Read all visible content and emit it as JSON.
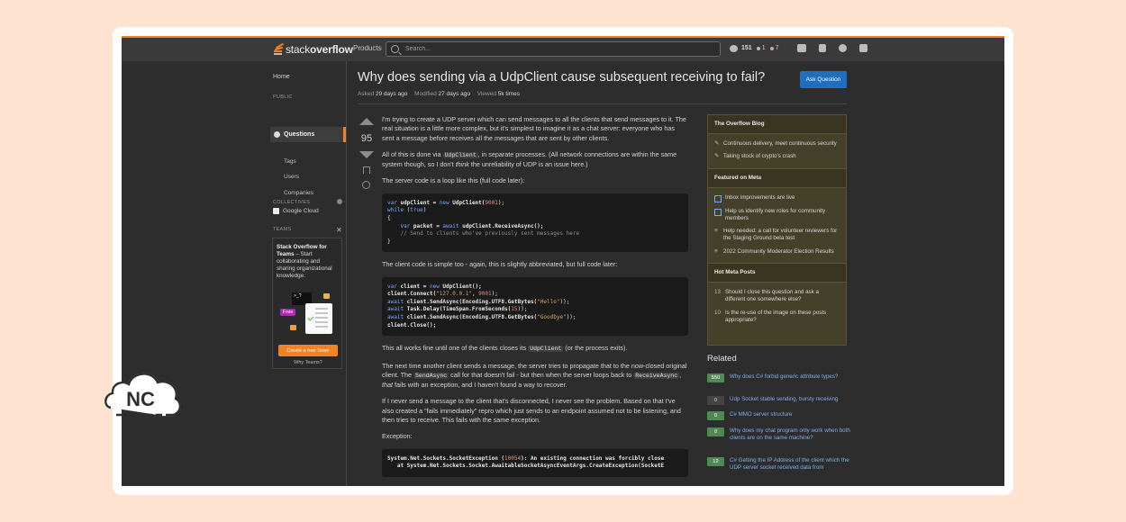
{
  "topbar": {
    "logo_light": "stack",
    "logo_bold": "overflow",
    "products": "Products",
    "search_placeholder": "Search...",
    "reputation": "151",
    "silver": "1",
    "bronze": "7"
  },
  "leftnav": {
    "home": "Home",
    "public": "PUBLIC",
    "questions": "Questions",
    "tags": "Tags",
    "users": "Users",
    "companies": "Companies",
    "collectives": "COLLECTIVES",
    "google_cloud": "Google Cloud",
    "teams": "TEAMS",
    "teams_title": "Stack Overflow for Teams",
    "teams_desc": " – Start collaborating and sharing organizational knowledge.",
    "free": "Free",
    "terminal": ">_?",
    "create_team": "Create a free Team",
    "why_teams": "Why Teams?"
  },
  "question": {
    "title": "Why does sending via a UdpClient cause subsequent receiving to fail?",
    "ask_button": "Ask Question",
    "asked_label": "Asked",
    "asked_value": "29 days ago",
    "modified_label": "Modified",
    "modified_value": "27 days ago",
    "viewed_label": "Viewed",
    "viewed_value": "5k times",
    "votes": "95"
  },
  "post": {
    "p1": "I'm trying to create a UDP server which can send messages to all the clients that send messages to it. The real situation is a little more complex, but it's simplest to imagine it as a chat server: everyone who has sent a message before receives all the messages that are sent by other clients.",
    "p2a": "All of this is done via ",
    "p2code": "UdpClient",
    "p2b": ", in separate processes. (All network connections are within the same system though, so I don't ",
    "p2em": "think",
    "p2c": " the unreliability of UDP is an issue here.)",
    "p3": "The server code is a loop like this (full code later):",
    "p4": "The client code is simple too - again, this is slightly abbreviated, but full code later:",
    "p5a": "This all works fine until one of the clients closes its ",
    "p5code": "UdpClient",
    "p5b": " (or the process exits).",
    "p6a": "The next time another client sends a message, the server tries to propagate that to the now-closed original client. The ",
    "p6code1": "SendAsync",
    "p6b": " call for that doesn't fail - but then when the server loops back to ",
    "p6code2": "ReceiveAsync",
    "p6c": ", ",
    "p6em": "that",
    "p6d": " fails with an exception, and I haven't found a way to recover.",
    "p7": "If I never send a message to the client that's disconnected, I never see the problem. Based on that I've also created a \"fails immediately\" repro which just sends to an endpoint assumed not to be listening, and then tries to receive. This fails with the same exception.",
    "p8": "Exception:",
    "server_code": {
      "l1_kw": "var",
      "l1_a": " udpClient = ",
      "l1_new": "new",
      "l1_b": " UdpClient(",
      "l1_num": "9001",
      "l1_c": ");",
      "l2_kw": "while",
      "l2_a": " (",
      "l2_true": "true",
      "l2_b": ")",
      "l3": "{",
      "l4_kw": "var",
      "l4_a": " packet = ",
      "l4_await": "await",
      "l4_b": " udpClient.ReceiveAsync();",
      "l5": "// Send to clients who've previously sent messages here",
      "l6": "}"
    },
    "client_code": {
      "l1_kw": "var",
      "l1_a": " client = ",
      "l1_new": "new",
      "l1_b": " UdpClient();",
      "l2_a": "client.Connect(",
      "l2_str": "\"127.0.0.1\"",
      "l2_b": ", ",
      "l2_num": "9001",
      "l2_c": ");",
      "l3_await": "await",
      "l3_a": " client.SendAsync(Encoding.UTF8.GetBytes(",
      "l3_str": "\"Hello\"",
      "l3_b": "));",
      "l4_await": "await",
      "l4_a": " Task.Delay(TimeSpan.FromSeconds(",
      "l4_num": "15",
      "l4_b": "));",
      "l5_await": "await",
      "l5_a": " client.SendAsync(Encoding.UTF8.GetBytes(",
      "l5_str": "\"Goodbye\"",
      "l5_b": "));",
      "l6": "client.Close();"
    },
    "exception_code": {
      "l1_a": "System.Net.Sockets.SocketException (",
      "l1_num": "10054",
      "l1_b": "): An existing connection was forcibly close",
      "l2": "   at System.Net.Sockets.Socket.AwaitableSocketAsyncEventArgs.CreateException(SocketE"
    }
  },
  "sidebar": {
    "blog_head": "The Overflow Blog",
    "blog_items": [
      "Continuous delivery, meet continuous security",
      "Taking stock of crypto's crash"
    ],
    "meta_head": "Featured on Meta",
    "meta_items": [
      "Inbox improvements are live",
      "Help us identify new roles for community members",
      "Help needed: a call for volunteer reviewers for the Staging Ground beta test",
      "2022 Community Moderator Election Results"
    ],
    "hot_head": "Hot Meta Posts",
    "hot_items": [
      {
        "num": "13",
        "text": "Should I close this question and ask a different one somewhere else?"
      },
      {
        "num": "10",
        "text": "Is the re-use of the image on these posts appropriate?"
      }
    ],
    "related_head": "Related",
    "related": [
      {
        "count": "550",
        "text": "Why does C# forbid generic attribute types?"
      },
      {
        "count": "0",
        "text": "Udp Socket stable sending, bursty receiving"
      },
      {
        "count": "0",
        "text": "C# MMO server structure"
      },
      {
        "count": "0",
        "text": "Why does my chat program only work when both clients are on the same machine?"
      },
      {
        "count": "12",
        "text": "C# Getting the IP Address of the client which the UDP server socket received data from"
      }
    ]
  },
  "watermark": {
    "text": "NC"
  },
  "colors": {
    "accent": "#f48225",
    "link": "#7fb1ee",
    "button": "#1e6fc0",
    "answered": "#4f8a55"
  }
}
